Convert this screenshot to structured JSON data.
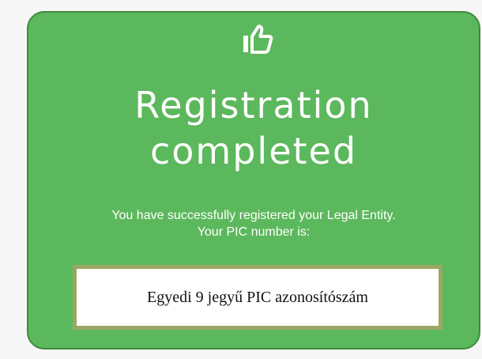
{
  "card": {
    "icon": "thumbs-up-icon",
    "title_line1": "Registration",
    "title_line2": "completed",
    "message_line1": "You have successfully registered your Legal Entity.",
    "message_line2": "Your PIC number is:",
    "pic_value": "Egyedi 9 jegyű PIC azonosítószám"
  },
  "colors": {
    "card_background": "#5cb85c",
    "card_border": "#3d8b3d",
    "pic_box_border": "#9aa864",
    "text": "#ffffff"
  }
}
